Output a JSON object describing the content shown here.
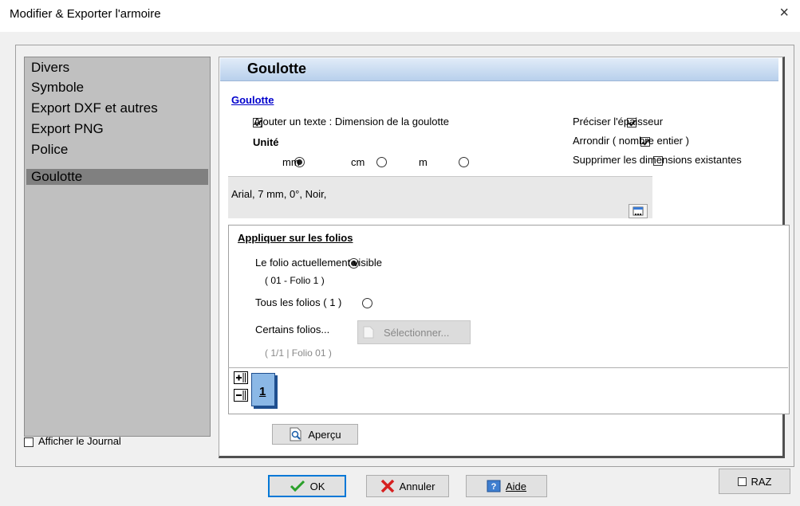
{
  "window": {
    "title": "Modifier & Exporter l'armoire",
    "close_glyph": "×"
  },
  "sidebar": {
    "items": [
      {
        "label": "Divers"
      },
      {
        "label": "Symbole"
      },
      {
        "label": "Export DXF et autres"
      },
      {
        "label": "Export PNG"
      },
      {
        "label": "Police"
      },
      {
        "label": "Goulotte",
        "selected": true
      }
    ],
    "journal_label": "Afficher le Journal",
    "journal_checked": false
  },
  "panel": {
    "title": "Goulotte",
    "section_label": "Goulotte",
    "add_text": {
      "label": "Ajouter un texte : Dimension de la goulotte",
      "checked": true
    },
    "unit": {
      "label": "Unité",
      "options": [
        {
          "label": "mm",
          "selected": true
        },
        {
          "label": "cm",
          "selected": false
        },
        {
          "label": "m",
          "selected": false
        }
      ]
    },
    "right_options": [
      {
        "label": "Préciser l'épaisseur",
        "checked": true
      },
      {
        "label": "Arrondir ( nombre entier )",
        "checked": true
      },
      {
        "label": "Supprimer les dimensions existantes",
        "checked": false
      }
    ],
    "font_summary": "Arial, 7 mm, 0°, Noir,",
    "apply": {
      "title": "Appliquer sur les folios",
      "visible_label": "Le folio actuellement visible",
      "visible_sub": "( 01 - Folio 1 )",
      "all_label": "Tous les folios ( 1 )",
      "some_label": "Certains folios...",
      "select_button": "Sélectionner...",
      "some_sub": "( 1/1  |  Folio 01 )",
      "page_number": "1"
    },
    "preview_button": "Aperçu"
  },
  "footer": {
    "ok": "OK",
    "cancel": "Annuler",
    "help": "Aide",
    "raz": "RAZ"
  },
  "colors": {
    "header_gradient_top": "#e1ecf8",
    "header_gradient_bottom": "#b8d0ec",
    "sidebar_bg": "#c0c0c0",
    "sidebar_selected": "#808080",
    "primary_border": "#0078d7"
  }
}
